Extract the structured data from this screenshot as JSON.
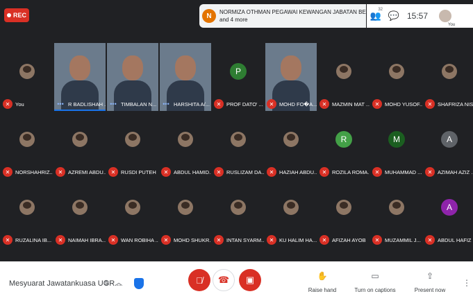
{
  "top": {
    "rec_label": "REC",
    "notification": {
      "initial": "N",
      "line1": "NORMIZA OTHMAN PEGAWAI KEWANGAN JABATAN BENDA...",
      "line2": "and 4 more"
    },
    "participants_count": "32",
    "time": "15:57",
    "self_label": "You"
  },
  "colors": {
    "red": "#d93025",
    "blue": "#1a73e8",
    "letter_p": "#2e7d32",
    "letter_r": "#43a047",
    "letter_m": "#1b5e20",
    "letter_a_gray": "#5f6368",
    "letter_a_purple": "#8e24aa"
  },
  "participants": [
    {
      "name": "You",
      "kind": "avatar"
    },
    {
      "name": "R BADLISHAH ...",
      "kind": "video",
      "speaking": true
    },
    {
      "name": "TIMBALAN N...",
      "kind": "video"
    },
    {
      "name": "HARSHITA A/...",
      "kind": "video"
    },
    {
      "name": "PROF DATO' ...",
      "kind": "letter",
      "letter": "P",
      "color": "#2e7d32"
    },
    {
      "name": "MOHD FO�A...",
      "kind": "video"
    },
    {
      "name": "MAZMIN MAT ...",
      "kind": "avatar"
    },
    {
      "name": "MOHD YUSOF...",
      "kind": "avatar"
    },
    {
      "name": "SHAFRIZA NIS...",
      "kind": "avatar"
    },
    {
      "name": "NORSHAHRIZ...",
      "kind": "avatar"
    },
    {
      "name": "AZREMI ABDU...",
      "kind": "avatar"
    },
    {
      "name": "RUSDI PUTEH",
      "kind": "avatar"
    },
    {
      "name": "ABDUL HAMID...",
      "kind": "avatar"
    },
    {
      "name": "RUSLIZAM DA...",
      "kind": "avatar"
    },
    {
      "name": "HAZIAH ABDU...",
      "kind": "avatar"
    },
    {
      "name": "ROZILA ROMA...",
      "kind": "letter",
      "letter": "R",
      "color": "#43a047"
    },
    {
      "name": "MUHAMMAD ...",
      "kind": "letter",
      "letter": "M",
      "color": "#1b5e20"
    },
    {
      "name": "AZIMAH AZIZ ...",
      "kind": "letter",
      "letter": "A",
      "color": "#5f6368"
    },
    {
      "name": "RUZALINA IB...",
      "kind": "avatar"
    },
    {
      "name": "NAIMAH IBRA...",
      "kind": "avatar"
    },
    {
      "name": "WAN ROBIHA ...",
      "kind": "avatar"
    },
    {
      "name": "MOHD SHUKR...",
      "kind": "avatar"
    },
    {
      "name": "INTAN SYARM...",
      "kind": "avatar"
    },
    {
      "name": "KU HALIM HA...",
      "kind": "avatar"
    },
    {
      "name": "AFIZAH AYOB",
      "kind": "avatar"
    },
    {
      "name": "MUZAMMIL J...",
      "kind": "avatar"
    },
    {
      "name": "ABDUL HAFIZ ...",
      "kind": "letter",
      "letter": "A",
      "color": "#8e24aa"
    }
  ],
  "bottom": {
    "meeting_name": "Mesyuarat Jawatankuasa UGR...",
    "raise_hand": "Raise hand",
    "captions": "Turn on captions",
    "present": "Present now"
  }
}
